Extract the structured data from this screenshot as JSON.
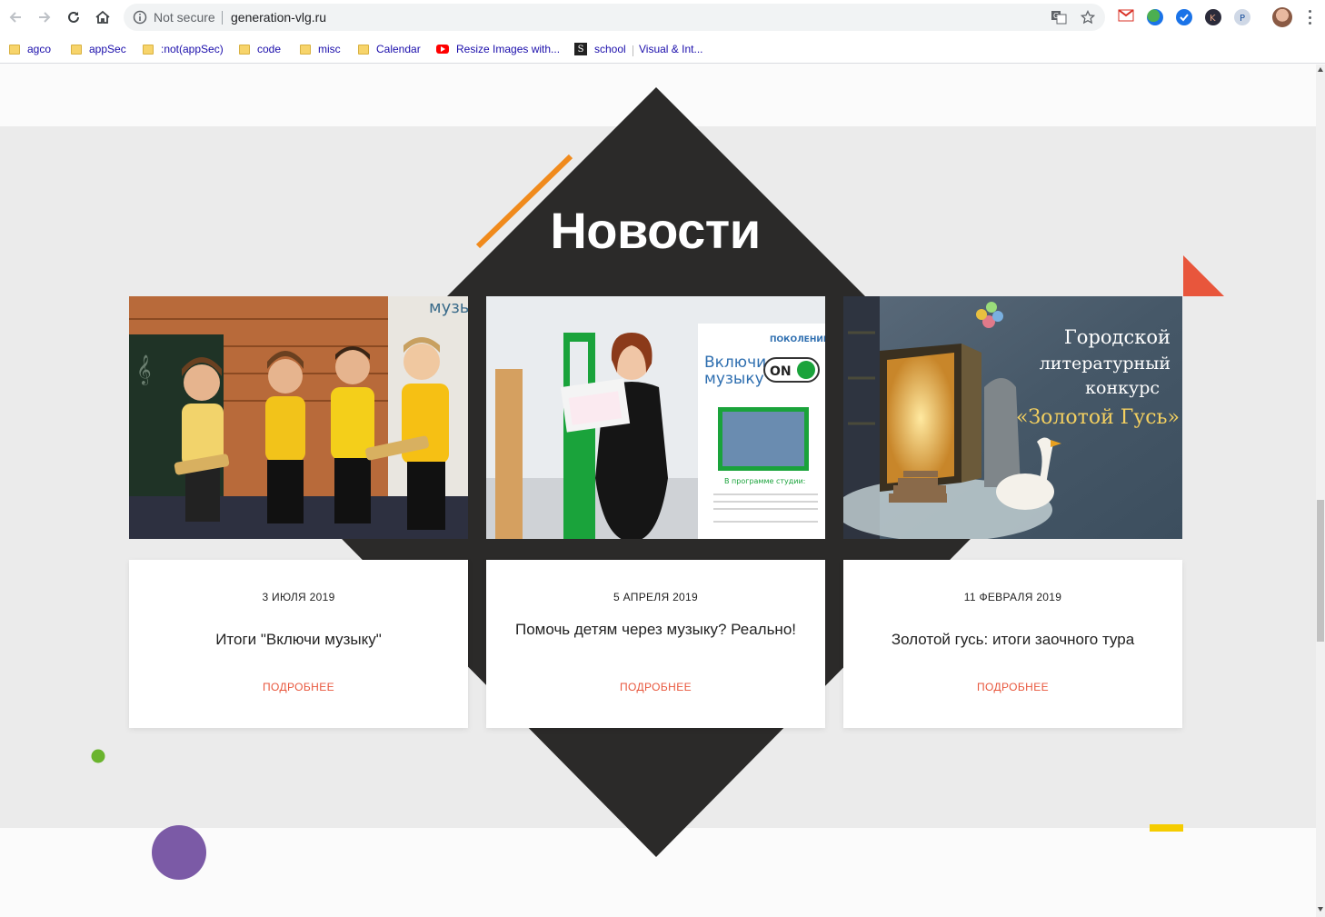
{
  "browser": {
    "security_label": "Not secure",
    "url": "generation-vlg.ru"
  },
  "bookmarks": [
    {
      "label": "agco",
      "icon": "folder-icon"
    },
    {
      "label": "appSec",
      "icon": "folder-icon"
    },
    {
      "label": ":not(appSec)",
      "icon": "folder-icon"
    },
    {
      "label": "code",
      "icon": "folder-icon"
    },
    {
      "label": "misc",
      "icon": "folder-icon"
    },
    {
      "label": "Calendar",
      "icon": "folder-icon"
    },
    {
      "label": "Resize Images with...",
      "icon": "youtube-icon"
    },
    {
      "label": "school",
      "icon": "s-icon"
    },
    {
      "label": "Visual & Int...",
      "icon": "none"
    }
  ],
  "news": {
    "heading": "Новости",
    "more_label": "ПОДРОБНЕЕ",
    "cards": [
      {
        "date": "3 ИЮЛЯ 2019",
        "title": "Итоги \"Включи музыку\""
      },
      {
        "date": "5 АПРЕЛЯ 2019",
        "title": "Помочь детям через музыку? Реально!"
      },
      {
        "date": "11 ФЕВРАЛЯ 2019",
        "title": "Золотой гусь: итоги заочного тура"
      }
    ],
    "photo2_banner": {
      "line1": "Включи",
      "line2": "музыку",
      "badge": "ON",
      "brand": "ПОКОЛЕНИЕ",
      "caption": "В программе студии:"
    },
    "photo3_overlay": {
      "line1": "Городской",
      "line2": "литературный",
      "line3": "конкурс",
      "line4": "«Золотой Гусь»"
    },
    "photo1_banner": "музы"
  },
  "colors": {
    "diamond": "#2b2a29",
    "accent_orange": "#f08a1c",
    "accent_red": "#e8563c",
    "accent_green": "#6ab42d",
    "accent_purple": "#7b5aa6",
    "accent_yellow": "#f5cc00",
    "band_gray": "#ebebeb"
  }
}
